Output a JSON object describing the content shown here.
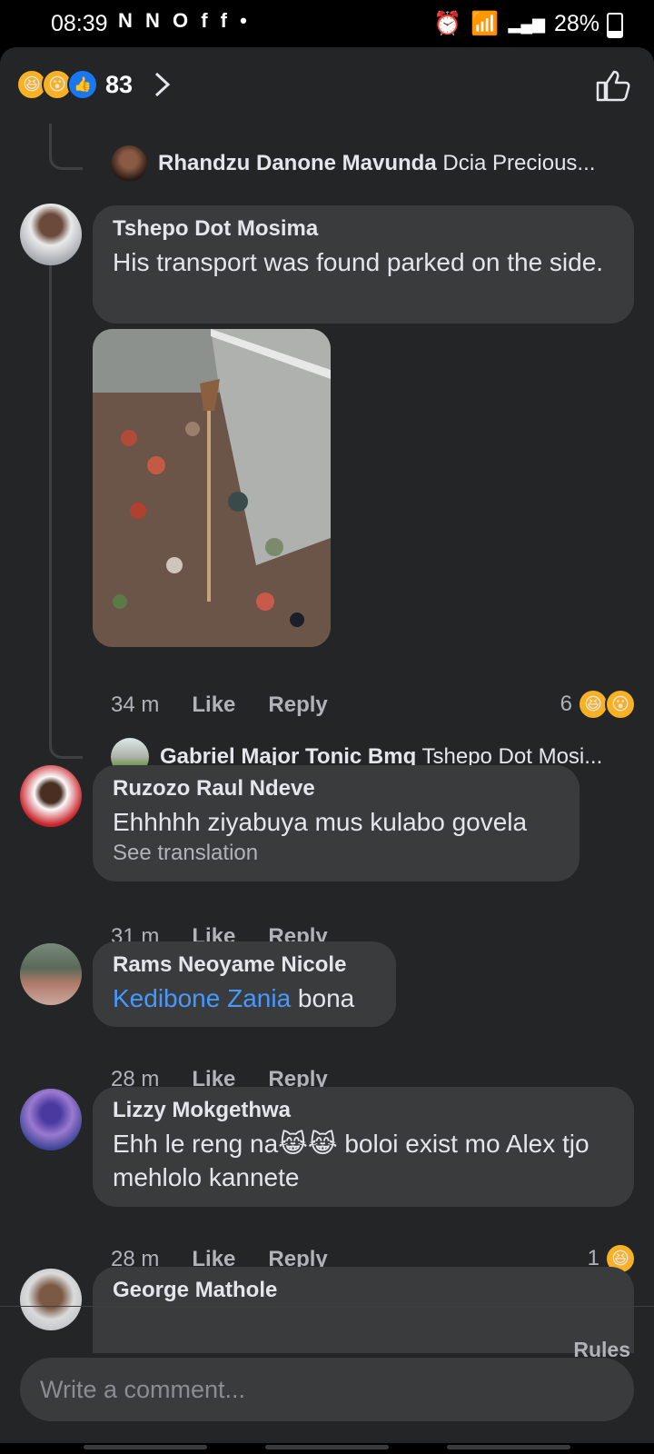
{
  "status_bar": {
    "time": "08:39",
    "notif_icons": "N N O f f •",
    "battery": "28%"
  },
  "reactions_header": {
    "count": "83",
    "reactions": [
      "haha",
      "wow",
      "like"
    ]
  },
  "thread_reply_1": {
    "author": "Rhandzu Danone Mavunda",
    "preview": "Dcia Precious..."
  },
  "comments": [
    {
      "author": "Tshepo Dot Mosima",
      "text": "His transport was found parked on the side.",
      "time": "34 m",
      "like": "Like",
      "reply": "Reply",
      "reaction_count": "6",
      "thread_reply": {
        "author": "Gabriel Major Tonic Bmq",
        "preview": "Tshepo Dot Mosi..."
      }
    },
    {
      "author": "Ruzozo Raul Ndeve",
      "text": "Ehhhhh ziyabuya mus kulabo govela",
      "see_translation": "See translation",
      "time": "31 m",
      "like": "Like",
      "reply": "Reply"
    },
    {
      "author": "Rams Neoyame Nicole",
      "mention": "Kedibone Zania",
      "text": " bona",
      "time": "28 m",
      "like": "Like",
      "reply": "Reply"
    },
    {
      "author": "Lizzy Mokgethwa",
      "text_a": "Ehh le reng na",
      "emoji": "😹😹",
      "text_b": " boloi exist mo Alex tjo mehlolo kannete",
      "time": "28 m",
      "like": "Like",
      "reply": "Reply",
      "reaction_count": "1"
    },
    {
      "author": "George Mathole"
    }
  ],
  "footer": {
    "rules": "Rules",
    "comment_placeholder": "Write a comment..."
  },
  "colors": {
    "background": "#242526",
    "bubble": "#3a3b3c",
    "mention": "#4599ff",
    "secondary_text": "#b0b3b8"
  }
}
